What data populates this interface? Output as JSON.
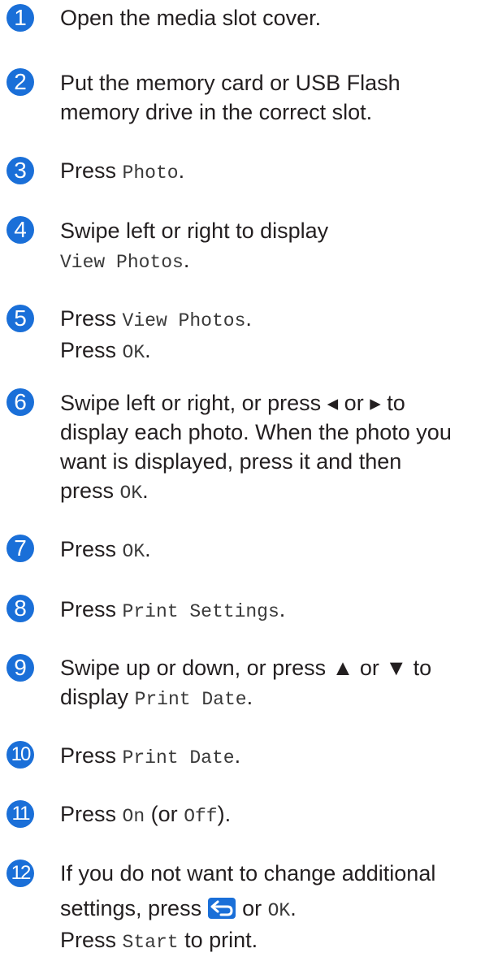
{
  "steps": [
    {
      "num": "1",
      "lines": [
        "Open the media slot cover."
      ]
    },
    {
      "num": "2",
      "lines": [
        "Put the memory card or USB Flash",
        "memory drive in the correct slot."
      ]
    },
    {
      "num": "3",
      "press": "Press",
      "key": "Photo"
    },
    {
      "num": "4",
      "line1": "Swipe left or right to display",
      "key": "View Photos"
    },
    {
      "num": "5",
      "press": "Press",
      "key": "View Photos",
      "press2": "Press",
      "key2": "OK"
    },
    {
      "num": "6",
      "lines": [
        "Swipe left or right, or press ◂ or ▸ to",
        "display each photo. When the photo you",
        "want is displayed, press it and then"
      ],
      "press": "press",
      "key": "OK"
    },
    {
      "num": "7",
      "press": "Press",
      "key": "OK"
    },
    {
      "num": "8",
      "press": "Press",
      "key": "Print Settings"
    },
    {
      "num": "9",
      "line1": "Swipe up or down, or press ▲ or ▼ to",
      "display": "display",
      "key": "Print Date"
    },
    {
      "num": "10",
      "press": "Press",
      "key": "Print Date"
    },
    {
      "num": "11",
      "press": "Press",
      "key": "On",
      "paren_open": "(or",
      "key2": "Off",
      "paren_close": ")."
    },
    {
      "num": "12",
      "line1": "If you do not want to change additional",
      "settings": "settings, press",
      "or": "or",
      "key": "OK",
      "press2": "Press",
      "key2": "Start",
      "to_print": "to print."
    }
  ],
  "icons": {
    "back": "back-arrow-icon"
  },
  "colors": {
    "badge": "#1a6fd8",
    "text": "#231f20"
  }
}
